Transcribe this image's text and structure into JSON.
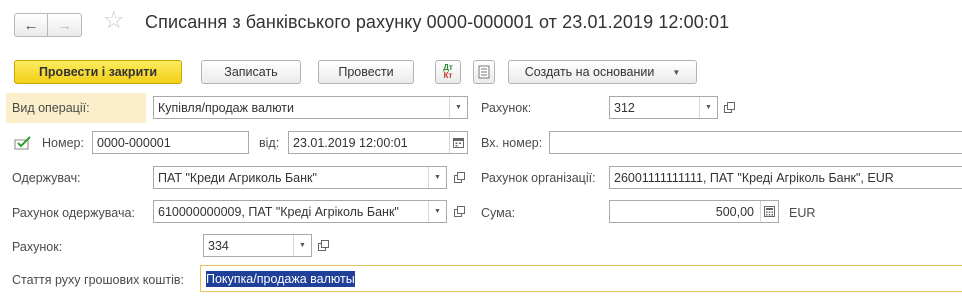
{
  "toolbar": {
    "title": "Списання з банківського рахунку 0000-000001 от 23.01.2019 12:00:01",
    "post_close_label": "Провести і закрити",
    "write_label": "Записать",
    "post_label": "Провести",
    "create_based_label": "Создать на основании",
    "dtkt_icon_top": "Дт",
    "dtkt_icon_bottom": "Кт"
  },
  "form": {
    "operation_label": "Вид операції:",
    "operation_value": "Купівля/продаж валюти",
    "number_label": "Номер:",
    "number_value": "0000-000001",
    "date_label": "від:",
    "date_value": "23.01.2019 12:00:01",
    "recipient_label": "Одержувач:",
    "recipient_value": "ПАТ \"Креди Агриколь Банк\"",
    "recipient_account_label": "Рахунок одержувача:",
    "recipient_account_value": "610000000009, ПАТ \"Креді Агріколь Банк\"",
    "account_label": "Рахунок:",
    "account_value": "334",
    "cashflow_label": "Стаття руху грошових коштів:",
    "cashflow_value": "Покупка/продажа валюты",
    "right_account_label": "Рахунок:",
    "right_account_value": "312",
    "incoming_number_label": "Вх. номер:",
    "incoming_number_value": "",
    "org_account_label": "Рахунок організації:",
    "org_account_value": "26001111111111, ПАТ \"Креді Агріколь Банк\", EUR",
    "amount_label": "Сума:",
    "amount_value": "500,00",
    "currency": "EUR"
  },
  "colors": {
    "primary_button": "#f5d31c",
    "operation_highlight": "#fbeecb",
    "selection": "#1f3f99",
    "focused_border": "#e6c35a"
  }
}
